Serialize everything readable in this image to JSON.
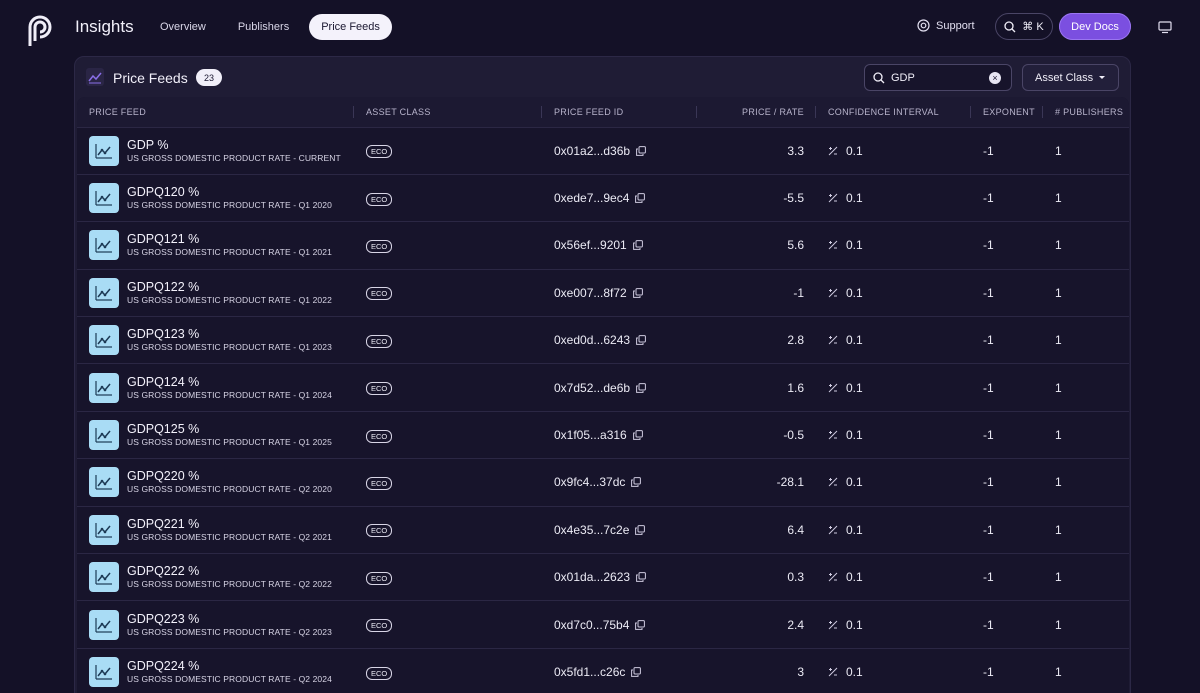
{
  "header": {
    "app_title": "Insights",
    "nav": [
      {
        "label": "Overview",
        "active": false
      },
      {
        "label": "Publishers",
        "active": false
      },
      {
        "label": "Price Feeds",
        "active": true
      }
    ],
    "support_label": "Support",
    "shortcut_label": "⌘ K",
    "devdocs_label": "Dev Docs"
  },
  "panel": {
    "title": "Price Feeds",
    "count": "23",
    "search_value": "GDP",
    "asset_class_label": "Asset Class"
  },
  "columns": [
    "PRICE FEED",
    "ASSET CLASS",
    "PRICE FEED ID",
    "PRICE / RATE",
    "CONFIDENCE INTERVAL",
    "EXPONENT",
    "# PUBLISHERS"
  ],
  "rows": [
    {
      "name": "GDP %",
      "desc": "US GROSS DOMESTIC PRODUCT RATE - CURRENT",
      "asset": "ECO",
      "id": "0x01a2...d36b",
      "price": "3.3",
      "ci": "0.1",
      "exponent": "-1",
      "publishers": "1"
    },
    {
      "name": "GDPQ120 %",
      "desc": "US GROSS DOMESTIC PRODUCT RATE - Q1 2020",
      "asset": "ECO",
      "id": "0xede7...9ec4",
      "price": "-5.5",
      "ci": "0.1",
      "exponent": "-1",
      "publishers": "1"
    },
    {
      "name": "GDPQ121 %",
      "desc": "US GROSS DOMESTIC PRODUCT RATE - Q1 2021",
      "asset": "ECO",
      "id": "0x56ef...9201",
      "price": "5.6",
      "ci": "0.1",
      "exponent": "-1",
      "publishers": "1"
    },
    {
      "name": "GDPQ122 %",
      "desc": "US GROSS DOMESTIC PRODUCT RATE - Q1 2022",
      "asset": "ECO",
      "id": "0xe007...8f72",
      "price": "-1",
      "ci": "0.1",
      "exponent": "-1",
      "publishers": "1"
    },
    {
      "name": "GDPQ123 %",
      "desc": "US GROSS DOMESTIC PRODUCT RATE - Q1 2023",
      "asset": "ECO",
      "id": "0xed0d...6243",
      "price": "2.8",
      "ci": "0.1",
      "exponent": "-1",
      "publishers": "1"
    },
    {
      "name": "GDPQ124 %",
      "desc": "US GROSS DOMESTIC PRODUCT RATE - Q1 2024",
      "asset": "ECO",
      "id": "0x7d52...de6b",
      "price": "1.6",
      "ci": "0.1",
      "exponent": "-1",
      "publishers": "1"
    },
    {
      "name": "GDPQ125 %",
      "desc": "US GROSS DOMESTIC PRODUCT RATE - Q1 2025",
      "asset": "ECO",
      "id": "0x1f05...a316",
      "price": "-0.5",
      "ci": "0.1",
      "exponent": "-1",
      "publishers": "1"
    },
    {
      "name": "GDPQ220 %",
      "desc": "US GROSS DOMESTIC PRODUCT RATE - Q2 2020",
      "asset": "ECO",
      "id": "0x9fc4...37dc",
      "price": "-28.1",
      "ci": "0.1",
      "exponent": "-1",
      "publishers": "1"
    },
    {
      "name": "GDPQ221 %",
      "desc": "US GROSS DOMESTIC PRODUCT RATE - Q2 2021",
      "asset": "ECO",
      "id": "0x4e35...7c2e",
      "price": "6.4",
      "ci": "0.1",
      "exponent": "-1",
      "publishers": "1"
    },
    {
      "name": "GDPQ222 %",
      "desc": "US GROSS DOMESTIC PRODUCT RATE - Q2 2022",
      "asset": "ECO",
      "id": "0x01da...2623",
      "price": "0.3",
      "ci": "0.1",
      "exponent": "-1",
      "publishers": "1"
    },
    {
      "name": "GDPQ223 %",
      "desc": "US GROSS DOMESTIC PRODUCT RATE - Q2 2023",
      "asset": "ECO",
      "id": "0xd7c0...75b4",
      "price": "2.4",
      "ci": "0.1",
      "exponent": "-1",
      "publishers": "1"
    },
    {
      "name": "GDPQ224 %",
      "desc": "US GROSS DOMESTIC PRODUCT RATE - Q2 2024",
      "asset": "ECO",
      "id": "0x5fd1...c26c",
      "price": "3",
      "ci": "0.1",
      "exponent": "-1",
      "publishers": "1"
    }
  ],
  "icons": {
    "logo": "pyth-logo",
    "support": "support-icon",
    "search": "search-icon",
    "monitor": "monitor-icon",
    "copy": "copy-icon",
    "chart": "line-chart-icon",
    "ci": "plus-minus-icon",
    "caret": "caret-down-icon"
  },
  "colors": {
    "accent": "#7b4fe0",
    "feed_icon_bg": "#a9dcf5",
    "background": "#141127"
  }
}
